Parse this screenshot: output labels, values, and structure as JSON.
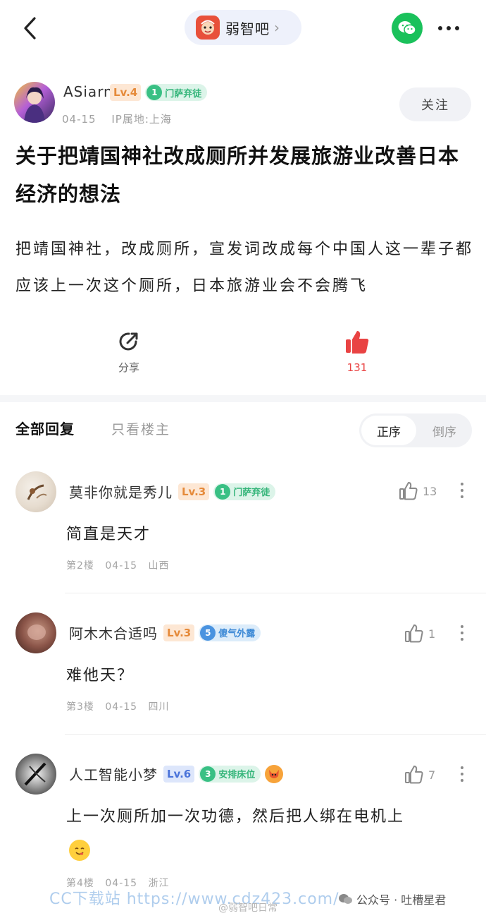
{
  "topbar": {
    "forum_name": "弱智吧",
    "forum_arrow": "›"
  },
  "author": {
    "name": "ASiarn",
    "level": "Lv.4",
    "tag_num": "1",
    "tag_text": "门萨弃徒",
    "date": "04-15",
    "ip": "IP属地:上海",
    "follow_label": "关注"
  },
  "post": {
    "title": "关于把靖国神社改成厕所并发展旅游业改善日本经济的想法",
    "body": "把靖国神社，改成厕所，宣发词改成每个中国人这一辈子都应该上一次这个厕所，日本旅游业会不会腾飞"
  },
  "actions": {
    "share_label": "分享",
    "like_count": "131"
  },
  "tabs": {
    "all_replies": "全部回复",
    "op_only": "只看楼主",
    "sort_asc": "正序",
    "sort_desc": "倒序"
  },
  "comments": [
    {
      "name": "莫非你就是秀儿",
      "level": "Lv.3",
      "tag_num": "1",
      "tag_text": "门萨弃徒",
      "likes": "13",
      "text": "简直是天才",
      "floor": "第2楼",
      "date": "04-15",
      "location": "山西"
    },
    {
      "name": "阿木木合适吗",
      "level": "Lv.3",
      "tag_num": "5",
      "tag_text": "傻气外露",
      "likes": "1",
      "text": "难他天？",
      "floor": "第3楼",
      "date": "04-15",
      "location": "四川"
    },
    {
      "name": "人工智能小梦",
      "level": "Lv.6",
      "tag_num": "3",
      "tag_text": "安排床位",
      "likes": "7",
      "text": "上一次厕所加一次功德，然后把人绑在电机上",
      "floor": "第4楼",
      "date": "04-15",
      "location": "浙江"
    }
  ],
  "watermark": {
    "text": "CC下载站  https://www.cdz423.com/",
    "source": "公众号 · 吐槽星君",
    "source2": "@弱智吧日常"
  },
  "colors": {
    "like_red": "#e94343",
    "wechat_green": "#1ac15b",
    "level_orange": "#e58a3a",
    "level_blue": "#4a73d9",
    "tag_green": "#35b57a",
    "tag_blue": "#3e8ad6"
  }
}
